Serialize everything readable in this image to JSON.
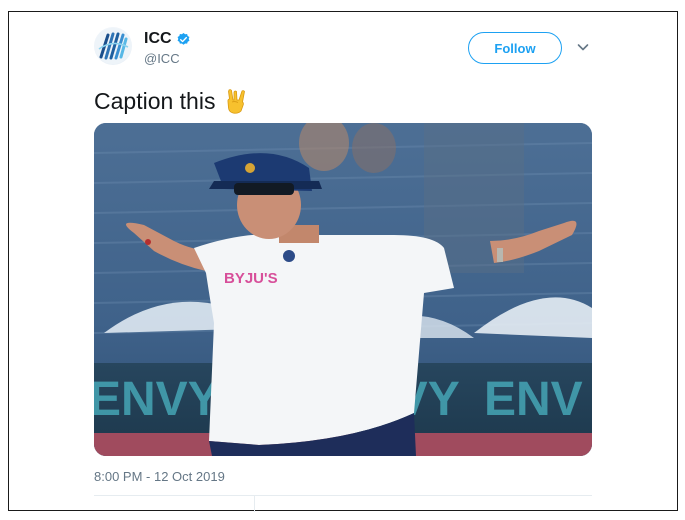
{
  "account": {
    "display_name": "ICC",
    "handle": "@ICC",
    "verified": true,
    "avatar_icon": "icc-logo-icon"
  },
  "header": {
    "follow_label": "Follow",
    "more_icon": "chevron-down-icon"
  },
  "tweet": {
    "text": "Caption this",
    "emoji_icon": "sign-of-the-horns-emoji",
    "timestamp": "8:00 PM - 12 Oct 2019"
  },
  "media": {
    "shirt_text": "BYJU'S",
    "banner_text": [
      "ENVY",
      "ENVY",
      "ENV"
    ]
  },
  "colors": {
    "accent": "#1da1f2",
    "text_primary": "#14171a",
    "text_secondary": "#657786",
    "divider": "#e6ecf0"
  }
}
